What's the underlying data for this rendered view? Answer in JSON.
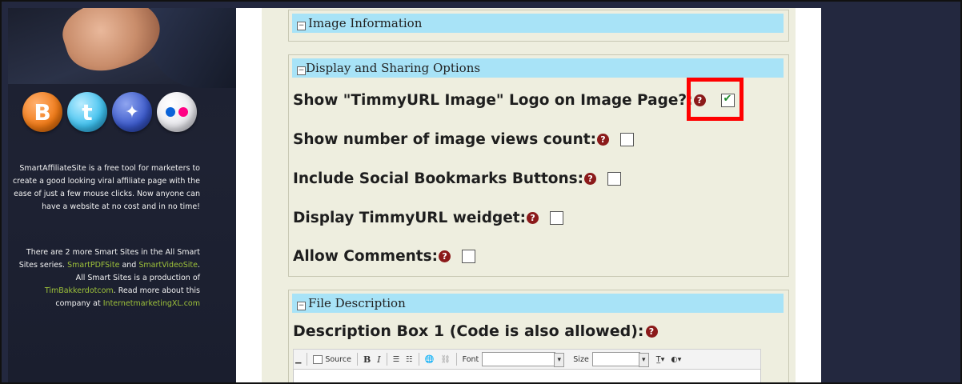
{
  "sidebar": {
    "social_icons": [
      {
        "name": "blogger-icon",
        "glyph": "B"
      },
      {
        "name": "twitter-icon",
        "glyph": "t"
      },
      {
        "name": "myspace-icon",
        "glyph": "✦"
      },
      {
        "name": "flickr-icon",
        "glyph": ""
      }
    ],
    "para1": "SmartAffiliateSite is a free tool for marketers to create a good looking viral affiliate page with the ease of just a few mouse clicks. Now anyone can have a website at no cost and in no time!",
    "para2_a": "There are 2 more Smart Sites in the All Smart Sites series.",
    "link_pdf": "SmartPDFSite",
    "para2_and": "and",
    "link_video": "SmartVideoSite",
    "para2_b": ". All Smart Sites is a production of",
    "link_tim": "TimBakkerdotcom",
    "para2_c": ". Read more about this company at",
    "link_xl": "InternetmarketingXL.com"
  },
  "sections": {
    "image_info": {
      "title": "Image Information"
    },
    "display": {
      "title": "Display and Sharing Options",
      "options": [
        {
          "label": "Show \"TimmyURL Image\" Logo on Image Page?:",
          "checked": true
        },
        {
          "label": "Show number of image views count:",
          "checked": false
        },
        {
          "label": "Include Social Bookmarks Buttons:",
          "checked": false
        },
        {
          "label": "Display TimmyURL weidget:",
          "checked": false
        },
        {
          "label": "Allow Comments:",
          "checked": false
        }
      ]
    },
    "file_desc": {
      "title": "File Description",
      "desc_label": "Description Box 1 (Code is also allowed):"
    }
  },
  "toolbar": {
    "source": "Source",
    "bold": "B",
    "italic": "I",
    "font_label": "Font",
    "size_label": "Size"
  },
  "colors": {
    "section_header": "#a8e3f7",
    "highlight": "#ff0000",
    "help_icon": "#8b1a1a",
    "sidebar_link": "#9ec23a"
  }
}
